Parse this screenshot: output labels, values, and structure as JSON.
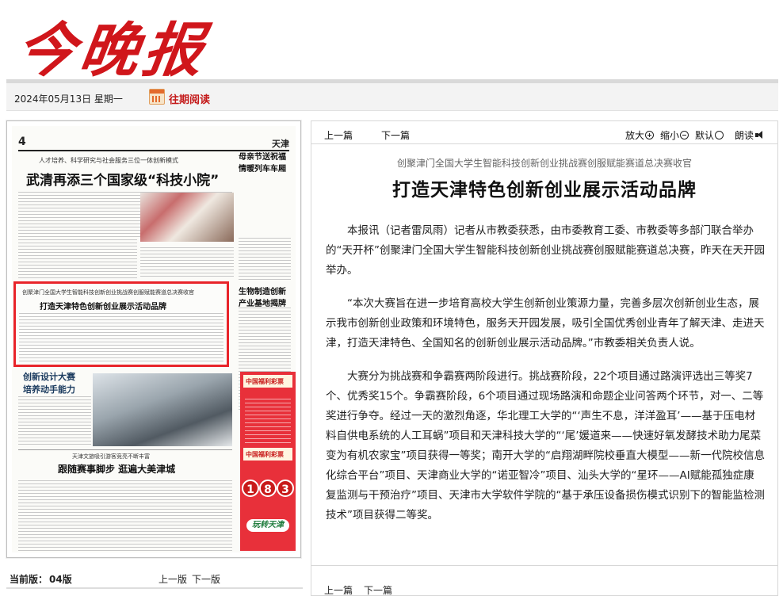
{
  "masthead": {
    "logo_text": "今晚报"
  },
  "datebar": {
    "date": "2024年05月13日 星期一",
    "past_reading": "往期阅读"
  },
  "thumbnail": {
    "page_number": "4",
    "page_section": "天津",
    "top_kicker": "人才培养、科学研究与社会服务三位一体创新模式",
    "top_headline": "武清再添三个国家级“科技小院”",
    "side1_headline": "母亲节送祝福\n情暖列车车厢",
    "side2_headline": "生物制造创新\n产业基地揭牌",
    "highlight_kicker": "创聚津门全国大学生智能科技创新创业挑战赛创服赋能赛道总决赛收官",
    "highlight_headline": "打造天津特色创新创业展示活动品牌",
    "left_headline": "创新设计大赛\n培养动手能力",
    "bottom_kicker": "天津文旅吸引游客竞亮不断丰富",
    "bottom_headline": "跟随赛事脚步 逛遍大美津城",
    "ad_title": "中国福利彩票",
    "ad_balls": [
      "1",
      "8",
      "3"
    ],
    "ad_logo": "玩转天津"
  },
  "left_footer": {
    "current_label": "当前版：",
    "current_value": "04版",
    "prev": "上一版",
    "next": "下一版"
  },
  "article": {
    "toolbar": {
      "prev": "上一篇",
      "next": "下一篇",
      "zoom_in": "放大",
      "zoom_out": "缩小",
      "default": "默认",
      "read": "朗读"
    },
    "subhead": "创聚津门全国大学生智能科技创新创业挑战赛创服赋能赛道总决赛收官",
    "headline": "打造天津特色创新创业展示活动品牌",
    "paragraphs": [
      "本报讯（记者雷凤雨）记者从市教委获悉，由市委教育工委、市教委等多部门联合举办的“天开杯”创聚津门全国大学生智能科技创新创业挑战赛创服赋能赛道总决赛，昨天在天开园举办。",
      "“本次大赛旨在进一步培育高校大学生创新创业策源力量，完善多层次创新创业生态，展示我市创新创业政策和环境特色，服务天开园发展，吸引全国优秀创业青年了解天津、走进天津，打造天津特色、全国知名的创新创业展示活动品牌。”市教委相关负责人说。",
      "大赛分为挑战赛和争霸赛两阶段进行。挑战赛阶段，22个项目通过路演评选出三等奖7个、优秀奖15个。争霸赛阶段，6个项目通过现场路演和命题企业问答两个环节，对一、二等奖进行争夺。经过一天的激烈角逐，华北理工大学的“‘声生不息，洋洋盈耳’——基于压电材料自供电系统的人工耳蜗”项目和天津科技大学的“‘尾’媛道来——快速好氧发酵技术助力尾菜变为有机农家宝”项目获得一等奖；南开大学的“启翔湖畔院校垂直大模型——新一代院校信息化综合平台”项目、天津商业大学的“诺亚智冷”项目、汕头大学的“星环——AI赋能孤独症康复监测与干预治疗”项目、天津市大学软件学院的“基于承压设备损伤模式识别下的智能监检测技术”项目获得二等奖。"
    ],
    "bottom_prev": "上一篇",
    "bottom_next": "下一篇"
  },
  "colors": {
    "brand_red": "#d0161b",
    "highlight_red": "#e8242a"
  }
}
